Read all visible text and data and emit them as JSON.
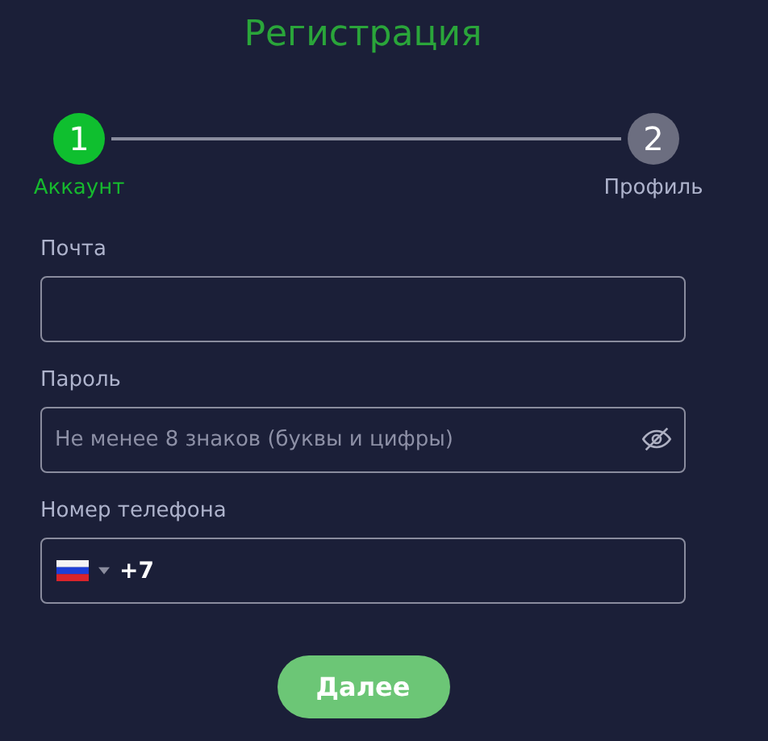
{
  "title": "Регистрация",
  "steps": [
    {
      "number": "1",
      "label": "Аккаунт",
      "selected": true
    },
    {
      "number": "2",
      "label": "Профиль",
      "selected": false
    }
  ],
  "fields": [
    {
      "kind": "text",
      "label": "Почта"
    },
    {
      "kind": "password",
      "label": "Пароль",
      "placeholder": "Не менее 8 знаков (буквы и цифры)"
    },
    {
      "kind": "phone",
      "label": "Номер телефона",
      "value": "+7"
    }
  ],
  "button": "Далее"
}
